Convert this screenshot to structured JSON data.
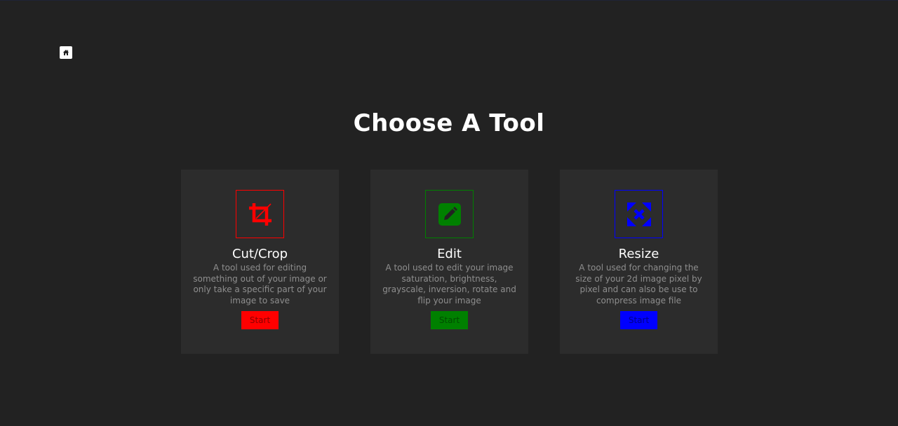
{
  "page": {
    "title": "Choose A Tool",
    "background": "#222222",
    "home_icon": "home-icon"
  },
  "tools": [
    {
      "title": "Cut/Crop",
      "description": "A tool used for editing something out of your image or only take a specific part of your image to save",
      "button_label": "Start",
      "icon": "crop-icon",
      "accent": "#ff0000",
      "button_text_color": "#8b0000"
    },
    {
      "title": "Edit",
      "description": "A tool used to edit your image saturation, brightness, grayscale, inversion, rotate and flip your image",
      "button_label": "Start",
      "icon": "pencil-square-icon",
      "accent": "#008000",
      "button_text_color": "#004d00"
    },
    {
      "title": "Resize",
      "description": "A tool used for changing the size of your 2d image pixel by pixel and can also be use to compress image file",
      "button_label": "Start",
      "icon": "expand-arrows-icon",
      "accent": "#0000ff",
      "button_text_color": "#000088"
    }
  ]
}
